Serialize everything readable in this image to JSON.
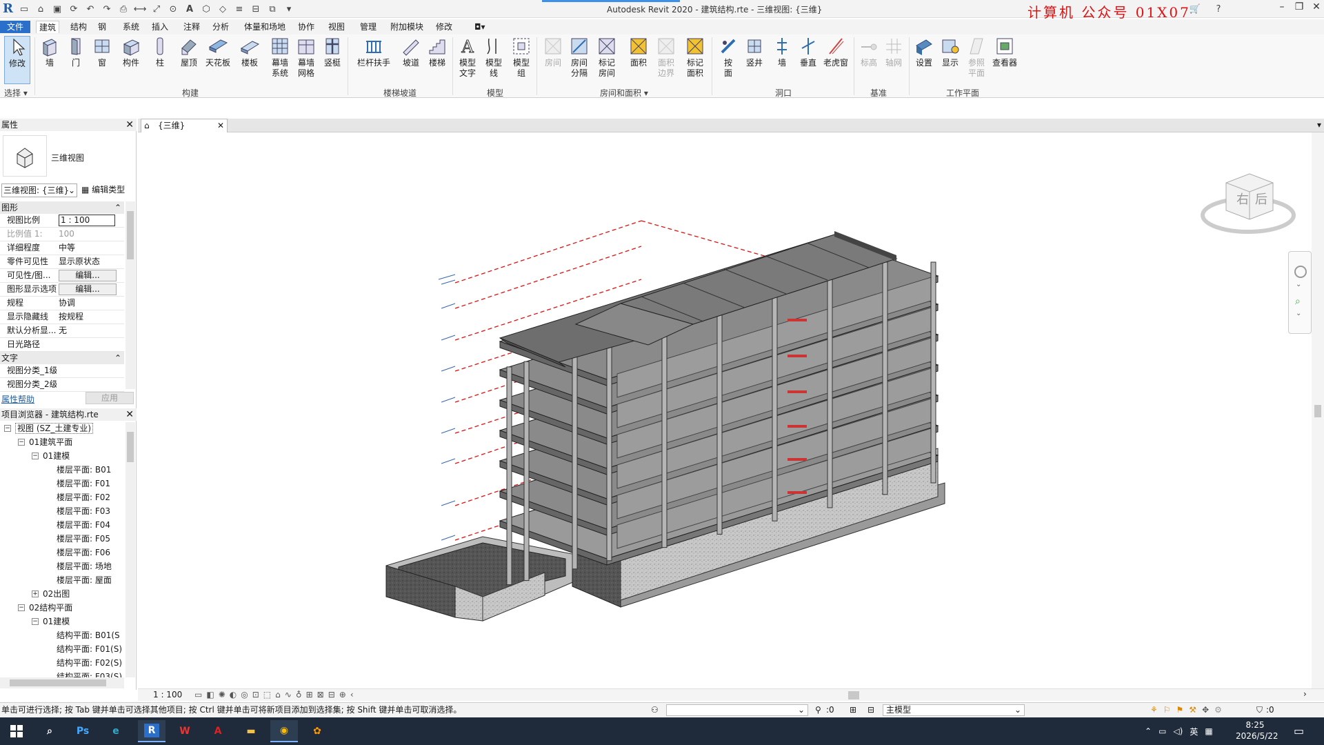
{
  "titlebar": {
    "title": "Autodesk Revit 2020 - 建筑结构.rte - 三维视图: {三维}",
    "watermark": "计算机 公众号 01X07",
    "app_logo": "R"
  },
  "menu": {
    "file": "文件",
    "tabs": [
      "建筑",
      "结构",
      "钢",
      "系统",
      "插入",
      "注释",
      "分析",
      "体量和场地",
      "协作",
      "视图",
      "管理",
      "附加模块",
      "修改"
    ]
  },
  "ribbon": {
    "modify": "修改",
    "select_panel": "选择",
    "build": {
      "wall": "墙",
      "door": "门",
      "window": "窗",
      "component": "构件",
      "column": "柱",
      "roof": "屋顶",
      "ceiling": "天花板",
      "floor": "楼板",
      "curtain_system": "幕墙\n系统",
      "curtain_grid": "幕墙\n网格",
      "mullion": "竖梃",
      "panel": "构建"
    },
    "circulation": {
      "railing": "栏杆扶手",
      "ramp": "坡道",
      "stair": "楼梯",
      "panel": "楼梯坡道"
    },
    "model": {
      "text": "模型\n文字",
      "line": "模型\n线",
      "group": "模型\n组",
      "panel": "模型"
    },
    "room": {
      "room": "房间",
      "separator": "房间\n分隔",
      "tag_room": "标记\n房间",
      "area": "面积",
      "area_boundary": "面积\n边界",
      "tag_area": "标记\n面积",
      "panel": "房间和面积"
    },
    "opening": {
      "by_face": "按\n面",
      "shaft": "竖井",
      "wall": "墙",
      "vertical": "垂直",
      "dormer": "老虎窗",
      "panel": "洞口"
    },
    "datum": {
      "level": "标高",
      "grid": "轴网",
      "panel": "基准"
    },
    "workplane": {
      "set": "设置",
      "show": "显示",
      "ref_plane": "参照\n平面",
      "viewer": "查看器",
      "panel": "工作平面"
    }
  },
  "properties": {
    "header": "属性",
    "type_name": "三维视图",
    "selector": "三维视图: {三维}",
    "edit_type": "编辑类型",
    "section_graphics": "图形",
    "rows": [
      {
        "k": "视图比例",
        "v": "1 : 100"
      },
      {
        "k": "比例值 1:",
        "v": "100"
      },
      {
        "k": "详细程度",
        "v": "中等"
      },
      {
        "k": "零件可见性",
        "v": "显示原状态"
      },
      {
        "k": "可见性/图...",
        "v": "编辑..."
      },
      {
        "k": "图形显示选项",
        "v": "编辑..."
      },
      {
        "k": "规程",
        "v": "协调"
      },
      {
        "k": "显示隐藏线",
        "v": "按规程"
      },
      {
        "k": "默认分析显...",
        "v": "无"
      },
      {
        "k": "日光路径",
        "v": ""
      }
    ],
    "section_text": "文字",
    "text_rows": [
      {
        "k": "视图分类_1级",
        "v": ""
      },
      {
        "k": "视图分类_2级",
        "v": ""
      }
    ],
    "help": "属性帮助",
    "apply": "应用"
  },
  "browser": {
    "header": "项目浏览器 - 建筑结构.rte",
    "items": [
      {
        "label": "视图 (SZ_土建专业)",
        "level": 0,
        "toggle": "-"
      },
      {
        "label": "01建筑平面",
        "level": 1,
        "toggle": "-"
      },
      {
        "label": "01建模",
        "level": 2,
        "toggle": "-"
      },
      {
        "label": "楼层平面: B01",
        "level": 3,
        "toggle": ""
      },
      {
        "label": "楼层平面: F01",
        "level": 3,
        "toggle": ""
      },
      {
        "label": "楼层平面: F02",
        "level": 3,
        "toggle": ""
      },
      {
        "label": "楼层平面: F03",
        "level": 3,
        "toggle": ""
      },
      {
        "label": "楼层平面: F04",
        "level": 3,
        "toggle": ""
      },
      {
        "label": "楼层平面: F05",
        "level": 3,
        "toggle": ""
      },
      {
        "label": "楼层平面: F06",
        "level": 3,
        "toggle": ""
      },
      {
        "label": "楼层平面: 场地",
        "level": 3,
        "toggle": ""
      },
      {
        "label": "楼层平面: 屋面",
        "level": 3,
        "toggle": ""
      },
      {
        "label": "02出图",
        "level": 2,
        "toggle": "+"
      },
      {
        "label": "02结构平面",
        "level": 1,
        "toggle": "-"
      },
      {
        "label": "01建模",
        "level": 2,
        "toggle": "-"
      },
      {
        "label": "结构平面: B01(S",
        "level": 3,
        "toggle": ""
      },
      {
        "label": "结构平面: F01(S)",
        "level": 3,
        "toggle": ""
      },
      {
        "label": "结构平面: F02(S)",
        "level": 3,
        "toggle": ""
      },
      {
        "label": "结构平面: F03(S)",
        "level": 3,
        "toggle": ""
      }
    ]
  },
  "view": {
    "tab_label": "{三维}",
    "viewcube_right": "右",
    "viewcube_back": "后",
    "scale": "1 : 100"
  },
  "status": {
    "hint": "单击可进行选择; 按 Tab 键并单击可选择其他项目; 按 Ctrl 键并单击可将新项目添加到选择集; 按 Shift 键并单击可取消选择。",
    "count": ":0",
    "model": "主模型",
    "filter_count": ":0"
  },
  "taskbar": {
    "ime": "英",
    "time": "8:25",
    "date": "2026/5/22"
  },
  "colors": {
    "accent": "#2a6fc9",
    "level_line": "#d11111",
    "concrete": "#8a8a8a"
  }
}
